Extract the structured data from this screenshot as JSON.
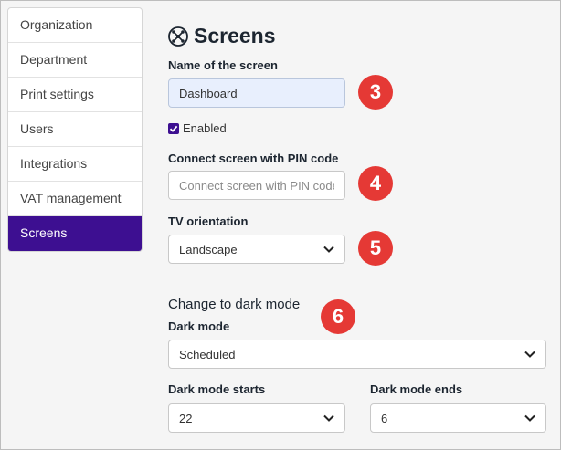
{
  "sidebar": {
    "items": [
      {
        "label": "Organization"
      },
      {
        "label": "Department"
      },
      {
        "label": "Print settings"
      },
      {
        "label": "Users"
      },
      {
        "label": "Integrations"
      },
      {
        "label": "VAT management"
      },
      {
        "label": "Screens",
        "active": true
      }
    ]
  },
  "header": {
    "title": "Screens",
    "icon": "screens-icon"
  },
  "form": {
    "name_label": "Name of the screen",
    "name_value": "Dashboard",
    "enabled_label": "Enabled",
    "enabled_checked": true,
    "pin_label": "Connect screen with PIN code",
    "pin_placeholder": "Connect screen with PIN code",
    "orientation_label": "TV orientation",
    "orientation_value": "Landscape",
    "dark_section_title": "Change to dark mode",
    "dark_mode_label": "Dark mode",
    "dark_mode_value": "Scheduled",
    "dark_starts_label": "Dark mode starts",
    "dark_starts_value": "22",
    "dark_ends_label": "Dark mode ends",
    "dark_ends_value": "6"
  },
  "badges": [
    "3",
    "4",
    "5",
    "6"
  ],
  "colors": {
    "accent": "#3d0f91",
    "badge": "#e53935",
    "filled_input": "#e8effd"
  }
}
